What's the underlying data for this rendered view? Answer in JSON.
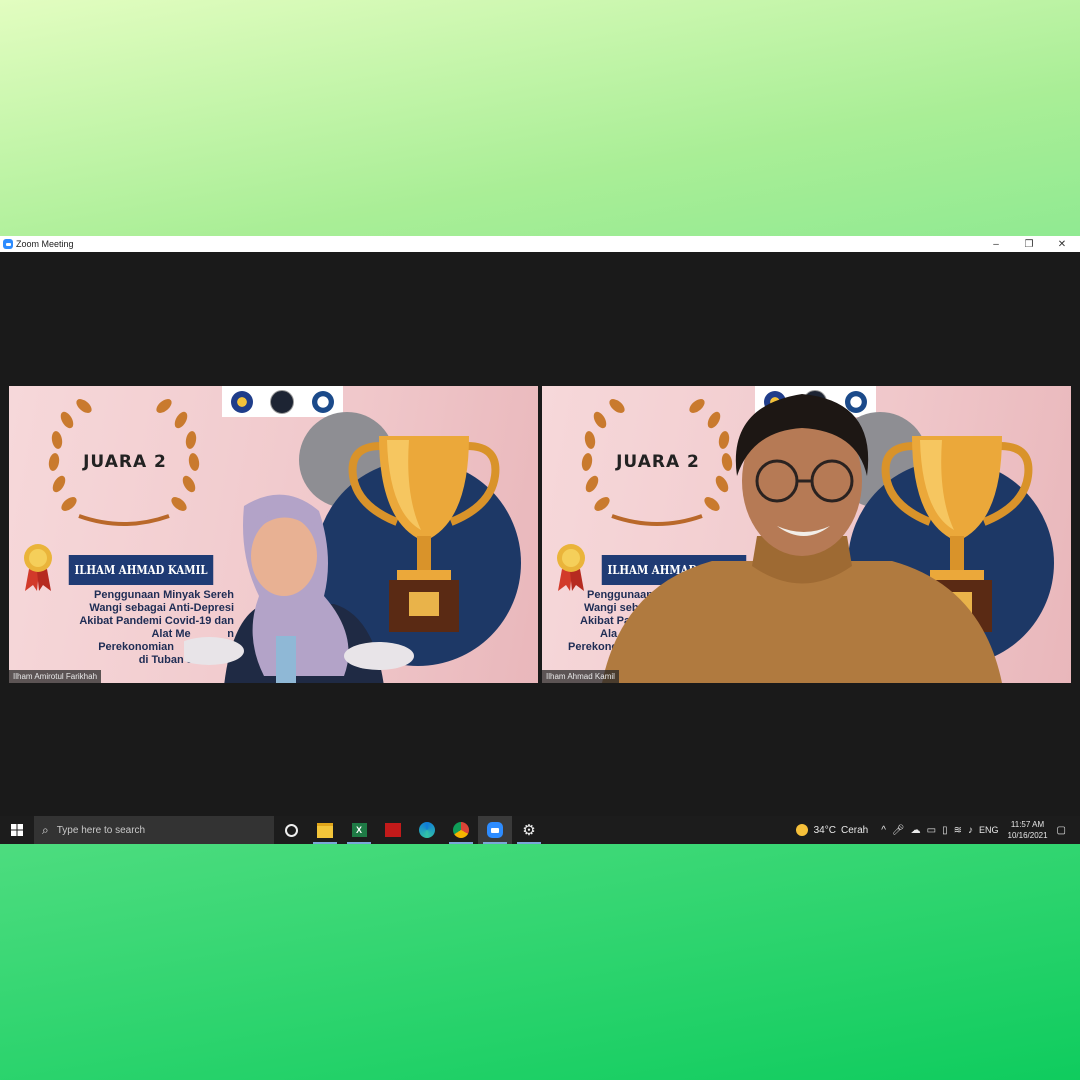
{
  "window": {
    "title": "Zoom Meeting",
    "controls": {
      "minimize": "–",
      "restore": "❐",
      "close": "✕"
    }
  },
  "slide": {
    "award": "JUARA 2",
    "name": "ILHAM AHMAD KAMIL",
    "left_description_lines": [
      "Penggunaan Minyak Sereh",
      "Wangi sebagai Anti-Depresi",
      "Akibat Pandemi Covid-19 dan",
      "Alat Me            n",
      "Perekonomian",
      "di Tuban Ja"
    ],
    "right_description_lines": [
      "Penggunaan",
      "Wangi seba",
      "Akibat Pa",
      "Ala",
      "Perekonomi"
    ]
  },
  "participants": [
    {
      "name": "Ilham Amirotul Farikhah"
    },
    {
      "name": "Ilham Ahmad Kamil"
    }
  ],
  "taskbar": {
    "search_placeholder": "Type here to search",
    "apps": [
      "cortana-icon",
      "file-explorer-icon",
      "excel-icon",
      "red-app-icon",
      "edge-icon",
      "chrome-icon",
      "zoom-icon",
      "settings-icon"
    ],
    "weather": {
      "temp": "34°C",
      "condition": "Cerah"
    },
    "language": "ENG",
    "time": "11:57 AM",
    "date": "10/16/2021"
  },
  "colors": {
    "zoom_blue": "#2d8cff",
    "slide_navy": "#1d3866",
    "slide_pink": "#f0c8cb",
    "gold": "#e9a93c"
  }
}
